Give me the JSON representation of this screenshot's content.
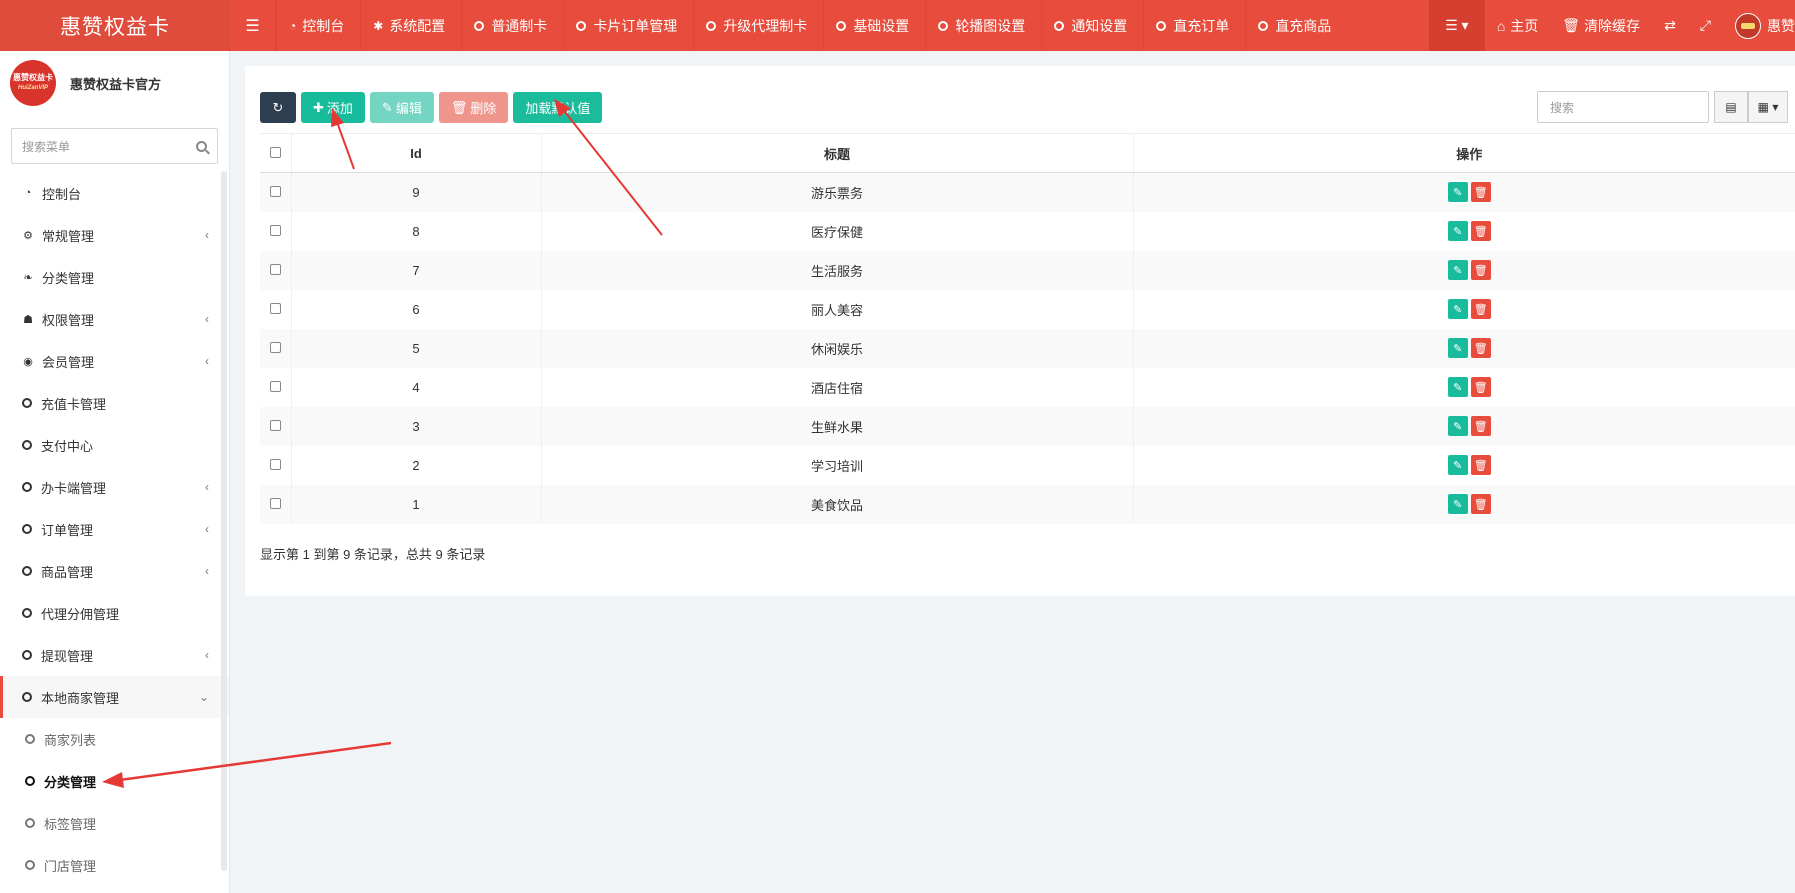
{
  "app": {
    "brand": "惠赞权益卡",
    "colors": {
      "primary": "#e74c3c",
      "green": "#18bc9c",
      "dark": "#2c3e50"
    }
  },
  "topnav": {
    "items": [
      {
        "label": "控制台",
        "icon": "dashboard-icon"
      },
      {
        "label": "系统配置",
        "icon": "gear-icon"
      },
      {
        "label": "普通制卡",
        "icon": "circle-icon"
      },
      {
        "label": "卡片订单管理",
        "icon": "circle-icon"
      },
      {
        "label": "升级代理制卡",
        "icon": "circle-icon"
      },
      {
        "label": "基础设置",
        "icon": "circle-icon"
      },
      {
        "label": "轮播图设置",
        "icon": "circle-icon"
      },
      {
        "label": "通知设置",
        "icon": "circle-icon"
      },
      {
        "label": "直充订单",
        "icon": "circle-icon"
      },
      {
        "label": "直充商品",
        "icon": "circle-icon"
      }
    ],
    "right": {
      "home": "主页",
      "clear_cache": "清除缓存",
      "user": "惠赞"
    }
  },
  "sidebar": {
    "user_name": "惠赞权益卡官方",
    "logo_text": "惠赞权益卡",
    "logo_sub": "HuiZanVIP",
    "search_placeholder": "搜索菜单",
    "items": [
      {
        "label": "控制台",
        "icon": "dashboard-icon"
      },
      {
        "label": "常规管理",
        "icon": "cogs-icon",
        "has_children": true
      },
      {
        "label": "分类管理",
        "icon": "leaf-icon"
      },
      {
        "label": "权限管理",
        "icon": "group-icon",
        "has_children": true
      },
      {
        "label": "会员管理",
        "icon": "user-circle-icon",
        "has_children": true
      },
      {
        "label": "充值卡管理",
        "icon": "circle-icon"
      },
      {
        "label": "支付中心",
        "icon": "circle-icon"
      },
      {
        "label": "办卡端管理",
        "icon": "circle-icon",
        "has_children": true
      },
      {
        "label": "订单管理",
        "icon": "circle-icon",
        "has_children": true
      },
      {
        "label": "商品管理",
        "icon": "circle-icon",
        "has_children": true
      },
      {
        "label": "代理分佣管理",
        "icon": "circle-icon"
      },
      {
        "label": "提现管理",
        "icon": "circle-icon",
        "has_children": true
      },
      {
        "label": "本地商家管理",
        "icon": "circle-icon",
        "expanded": true
      }
    ],
    "subitems": [
      {
        "label": "商家列表"
      },
      {
        "label": "分类管理",
        "active": true
      },
      {
        "label": "标签管理"
      },
      {
        "label": "门店管理"
      }
    ]
  },
  "toolbar": {
    "refresh": "refresh-icon",
    "add": "添加",
    "edit": "编辑",
    "delete": "删除",
    "load_default": "加载默认值",
    "search_placeholder": "搜索"
  },
  "table": {
    "headers": [
      "Id",
      "标题",
      "操作"
    ],
    "rows": [
      {
        "id": "9",
        "title": "游乐票务"
      },
      {
        "id": "8",
        "title": "医疗保健"
      },
      {
        "id": "7",
        "title": "生活服务"
      },
      {
        "id": "6",
        "title": "丽人美容"
      },
      {
        "id": "5",
        "title": "休闲娱乐"
      },
      {
        "id": "4",
        "title": "酒店住宿"
      },
      {
        "id": "3",
        "title": "生鲜水果"
      },
      {
        "id": "2",
        "title": "学习培训"
      },
      {
        "id": "1",
        "title": "美食饮品"
      }
    ],
    "footer": "显示第 1 到第 9 条记录，总共 9 条记录"
  }
}
